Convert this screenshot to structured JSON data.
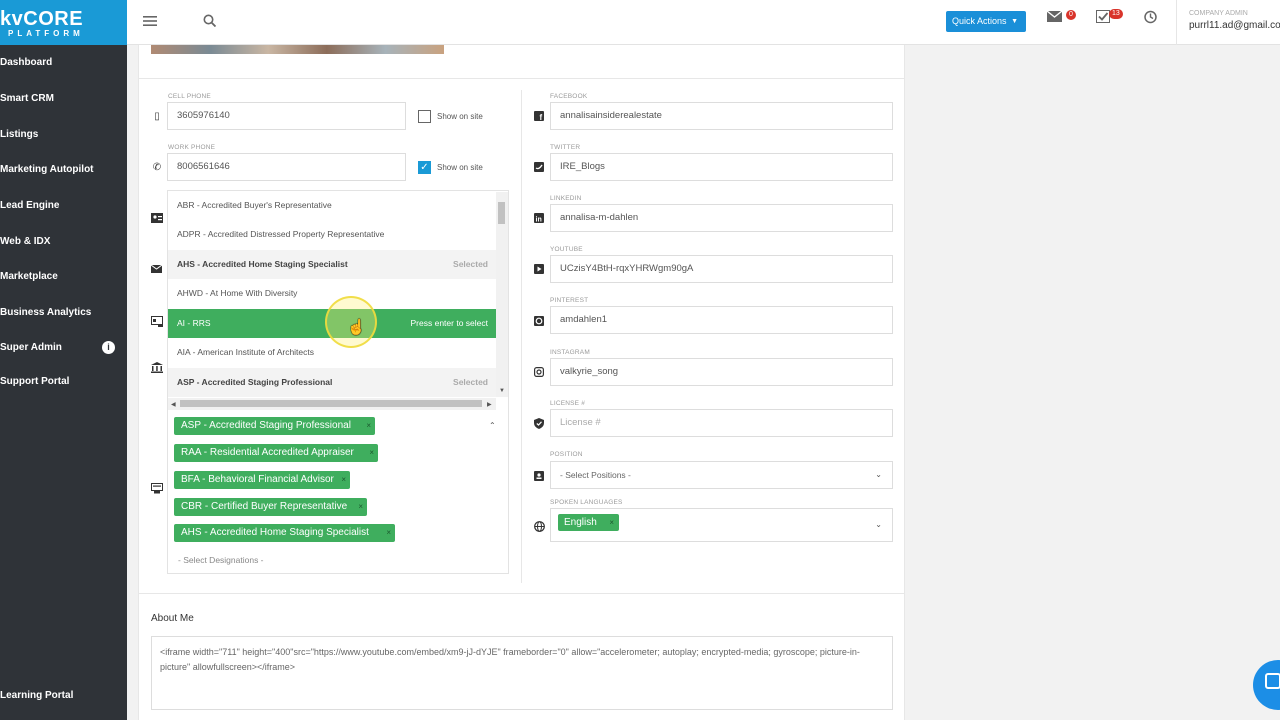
{
  "logo": {
    "line1": "kvCORE",
    "line2": "PLATFORM"
  },
  "sidebar": {
    "items": [
      {
        "label": "Dashboard"
      },
      {
        "label": "Smart CRM"
      },
      {
        "label": "Listings"
      },
      {
        "label": "Marketing Autopilot"
      },
      {
        "label": "Lead Engine"
      },
      {
        "label": "Web & IDX"
      },
      {
        "label": "Marketplace"
      },
      {
        "label": "Business Analytics"
      },
      {
        "label": "Super Admin"
      },
      {
        "label": "Support Portal"
      },
      {
        "label": "Learning Portal"
      }
    ],
    "super_admin_badge": "i"
  },
  "topbar": {
    "quick_actions": "Quick Actions",
    "mail_count": "0",
    "tasks_count": "13",
    "account_role": "COMPANY ADMIN",
    "account_email": "purrl11.ad@gmail.co"
  },
  "contact": {
    "cell_phone_label": "CELL PHONE",
    "cell_phone": "3605976140",
    "work_phone_label": "WORK PHONE",
    "work_phone": "8006561646",
    "show_on_site": "Show on site",
    "cell_show_checked": false,
    "work_show_checked": true
  },
  "designation_dropdown": {
    "options": [
      {
        "label": "ABR - Accredited Buyer's Representative",
        "state": ""
      },
      {
        "label": "ADPR - Accredited Distressed Property Representative",
        "state": ""
      },
      {
        "label": "AHS - Accredited Home Staging Specialist",
        "state": "Selected"
      },
      {
        "label": "AHWD - At Home With Diversity",
        "state": ""
      },
      {
        "label": "AI - RRS",
        "state": "Press enter to select"
      },
      {
        "label": "AIA - American Institute of Architects",
        "state": ""
      },
      {
        "label": "ASP - Accredited Staging Professional",
        "state": "Selected"
      }
    ],
    "selected_tags": [
      "ASP - Accredited Staging Professional",
      "RAA - Residential Accredited Appraiser",
      "BFA - Behavioral Financial Advisor",
      "CBR - Certified Buyer Representative",
      "AHS - Accredited Home Staging Specialist"
    ],
    "remove_glyph": "×",
    "placeholder": "- Select Designations -"
  },
  "social": {
    "facebook_label": "FACEBOOK",
    "facebook": "annalisainsiderealestate",
    "twitter_label": "TWITTER",
    "twitter": "IRE_Blogs",
    "linkedin_label": "LINKEDIN",
    "linkedin": "annalisa-m-dahlen",
    "youtube_label": "YOUTUBE",
    "youtube": "UCzisY4BtH-rqxYHRWgm90gA",
    "pinterest_label": "PINTEREST",
    "pinterest": "amdahlen1",
    "instagram_label": "INSTAGRAM",
    "instagram": "valkyrie_song",
    "license_label": "LICENSE #",
    "license_placeholder": "License #",
    "position_label": "POSITION",
    "position_placeholder": "- Select Positions -",
    "languages_label": "SPOKEN LANGUAGES",
    "language_tag": "English"
  },
  "about": {
    "title": "About Me",
    "text": "<iframe width=\"711\" height=\"400\"src=\"https://www.youtube.com/embed/xm9-jJ-dYJE\" frameborder=\"0\" allow=\"accelerometer; autoplay; encrypted-media; gyroscope; picture-in-picture\" allowfullscreen></iframe>"
  },
  "colors": {
    "brand_blue": "#1a9ad6",
    "tag_green": "#3fae5e",
    "sidebar": "#2f3338"
  }
}
